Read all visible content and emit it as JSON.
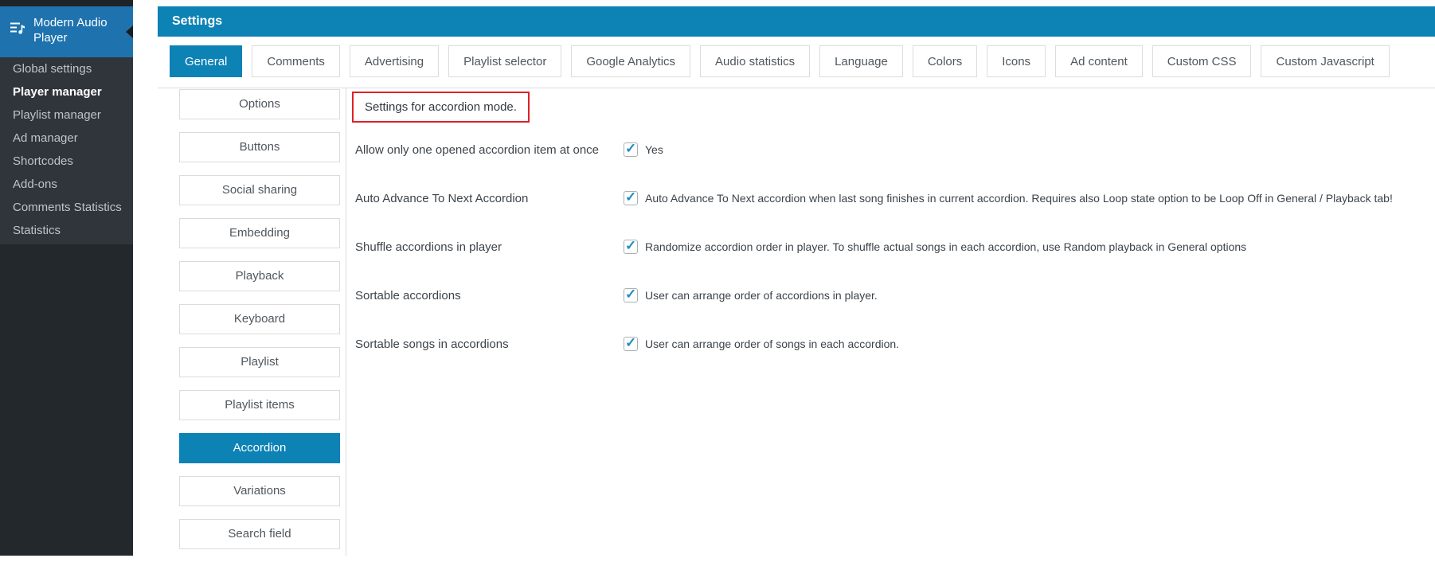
{
  "sidebar": {
    "plugin": {
      "title": "Modern Audio Player"
    },
    "items": [
      {
        "label": "Global settings",
        "current": false
      },
      {
        "label": "Player manager",
        "current": true
      },
      {
        "label": "Playlist manager",
        "current": false
      },
      {
        "label": "Ad manager",
        "current": false
      },
      {
        "label": "Shortcodes",
        "current": false
      },
      {
        "label": "Add-ons",
        "current": false
      },
      {
        "label": "Comments Statistics",
        "current": false
      },
      {
        "label": "Statistics",
        "current": false
      }
    ]
  },
  "header": {
    "title": "Settings"
  },
  "tabs": {
    "items": [
      {
        "label": "General",
        "active": true
      },
      {
        "label": "Comments",
        "active": false
      },
      {
        "label": "Advertising",
        "active": false
      },
      {
        "label": "Playlist selector",
        "active": false
      },
      {
        "label": "Google Analytics",
        "active": false
      },
      {
        "label": "Audio statistics",
        "active": false
      },
      {
        "label": "Language",
        "active": false
      },
      {
        "label": "Colors",
        "active": false
      },
      {
        "label": "Icons",
        "active": false
      },
      {
        "label": "Ad content",
        "active": false
      },
      {
        "label": "Custom CSS",
        "active": false
      },
      {
        "label": "Custom Javascript",
        "active": false
      }
    ]
  },
  "subnav": {
    "items": [
      {
        "label": "Options",
        "active": false
      },
      {
        "label": "Buttons",
        "active": false
      },
      {
        "label": "Social sharing",
        "active": false
      },
      {
        "label": "Embedding",
        "active": false
      },
      {
        "label": "Playback",
        "active": false
      },
      {
        "label": "Keyboard",
        "active": false
      },
      {
        "label": "Playlist",
        "active": false
      },
      {
        "label": "Playlist items",
        "active": false
      },
      {
        "label": "Accordion",
        "active": true
      },
      {
        "label": "Variations",
        "active": false
      },
      {
        "label": "Search field",
        "active": false
      }
    ]
  },
  "settings": {
    "notice": "Settings for accordion mode.",
    "rows": [
      {
        "label": "Allow only one opened accordion item at once",
        "checked": true,
        "description": "Yes"
      },
      {
        "label": "Auto Advance To Next Accordion",
        "checked": true,
        "description": "Auto Advance To Next accordion when last song finishes in current accordion. Requires also Loop state option to be Loop Off in General / Playback tab!"
      },
      {
        "label": "Shuffle accordions in player",
        "checked": true,
        "description": "Randomize accordion order in player. To shuffle actual songs in each accordion, use Random playback in General options"
      },
      {
        "label": "Sortable accordions",
        "checked": true,
        "description": "User can arrange order of accordions in player."
      },
      {
        "label": "Sortable songs in accordions",
        "checked": true,
        "description": "User can arrange order of songs in each accordion."
      }
    ]
  },
  "colors": {
    "accent_blue": "#0d82b5",
    "sidebar_header_blue": "#1e73af",
    "notice_border_red": "#df2128",
    "checkbox_check_blue": "#1f8dbe"
  }
}
